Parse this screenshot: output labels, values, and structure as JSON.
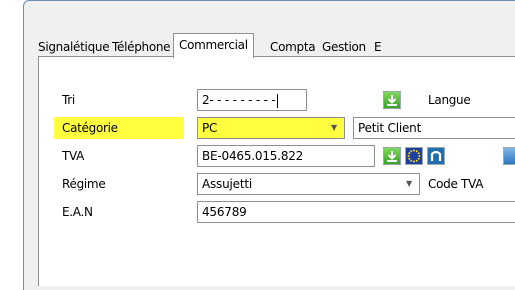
{
  "tabs": [
    {
      "label": "Signalétique",
      "active": false
    },
    {
      "label": "Téléphone",
      "active": false
    },
    {
      "label": "Commercial",
      "active": true
    },
    {
      "label": "Compta",
      "active": false
    },
    {
      "label": "Gestion",
      "active": false
    },
    {
      "label": "E",
      "active": false
    }
  ],
  "fields": {
    "tri": {
      "label": "Tri",
      "value": "2- - - - - - - - -"
    },
    "langue": {
      "label": "Langue"
    },
    "categorie": {
      "label": "Catégorie",
      "value": "PC",
      "description": "Petit Client"
    },
    "tva": {
      "label": "TVA",
      "value": "BE-0465.015.822"
    },
    "regime": {
      "label": "Régime",
      "value": "Assujetti",
      "code_label": "Code TVA"
    },
    "ean": {
      "label": "E.A.N",
      "value": "456789"
    }
  },
  "icons": {
    "download": "green-down-arrow-icon",
    "eu": "eu-flag-icon",
    "logo": "n-logo-icon",
    "partial": "blue-partial-icon"
  },
  "colors": {
    "highlight": "#ffff40",
    "tab_border": "#8e8f8f",
    "window_border": "#6d8fb5"
  }
}
